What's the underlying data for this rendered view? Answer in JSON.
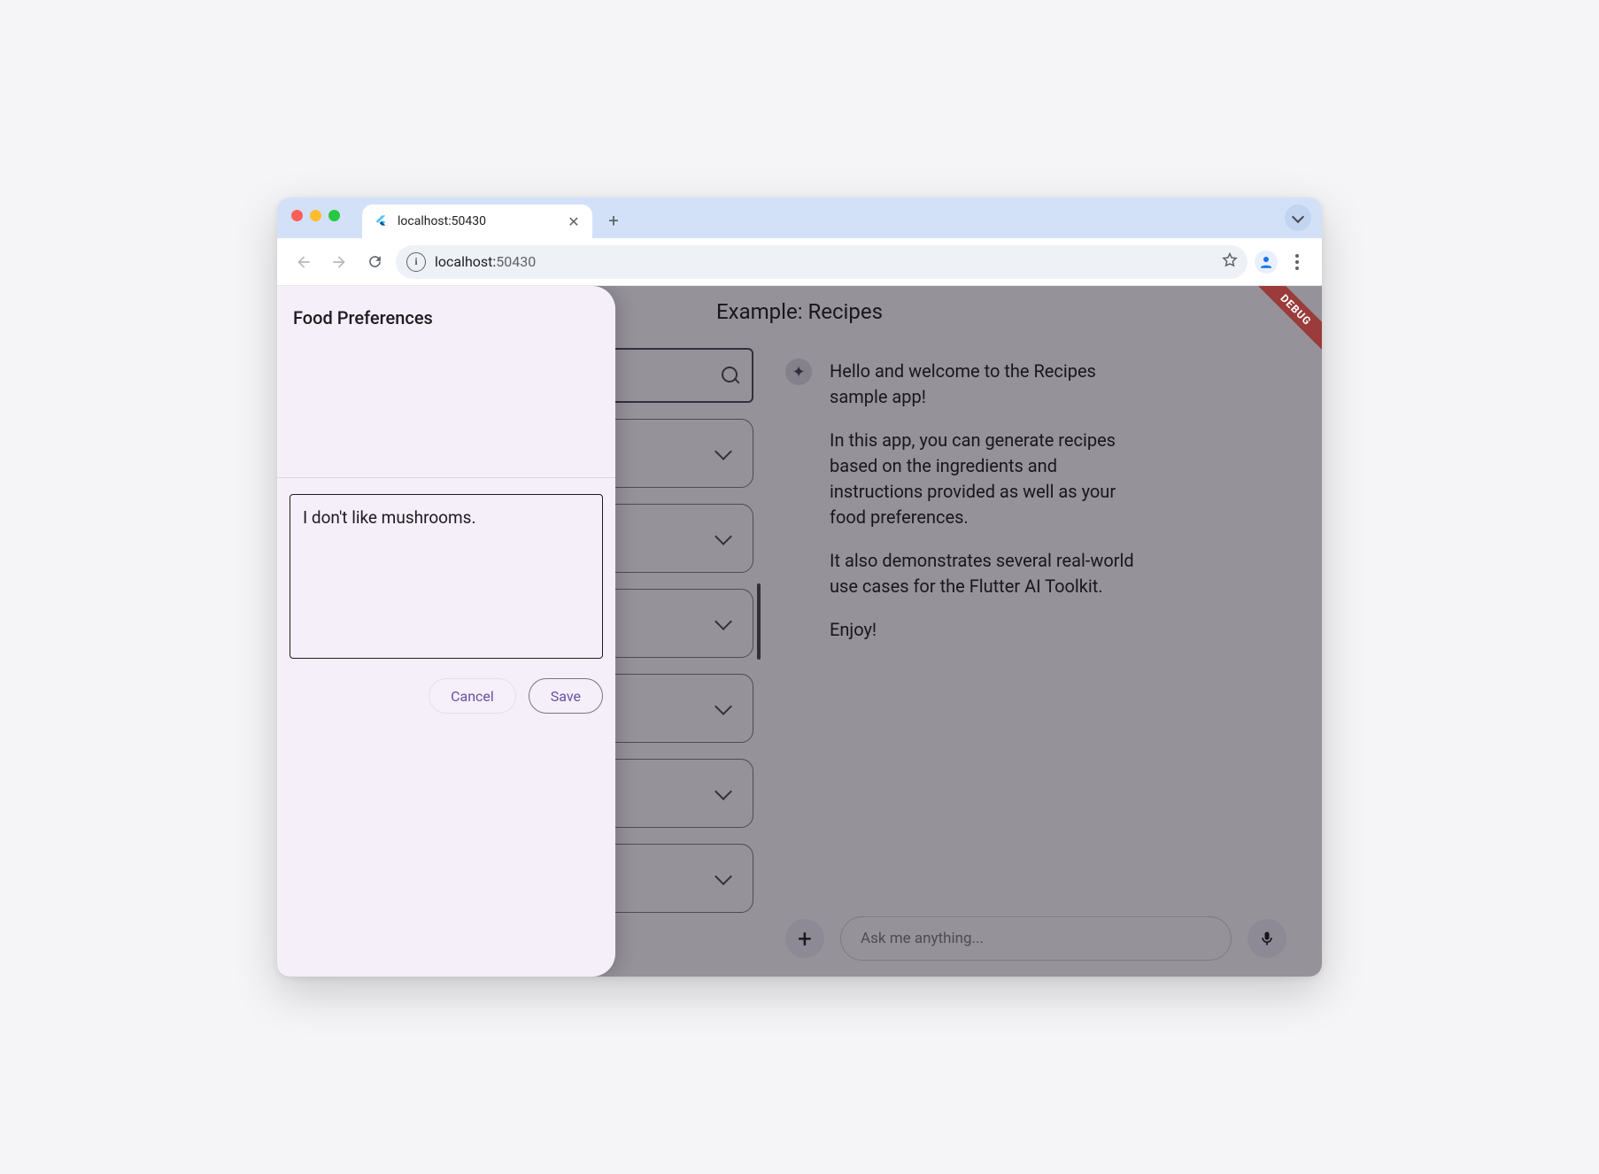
{
  "browser": {
    "tab_title": "localhost:50430",
    "url_host": "localhost:",
    "url_port": "50430"
  },
  "app": {
    "title": "Example: Recipes",
    "debug_label": "DEBUG"
  },
  "chat": {
    "welcome": [
      "Hello and welcome to the Recipes sample app!",
      "In this app, you can generate recipes based on the ingredients and instructions provided as well as your food preferences.",
      "It also demonstrates several real-world use cases for the Flutter AI Toolkit.",
      "Enjoy!"
    ],
    "input_placeholder": "Ask me anything..."
  },
  "drawer": {
    "title": "Food Preferences",
    "value": "I don't like mushrooms.",
    "cancel": "Cancel",
    "save": "Save"
  }
}
